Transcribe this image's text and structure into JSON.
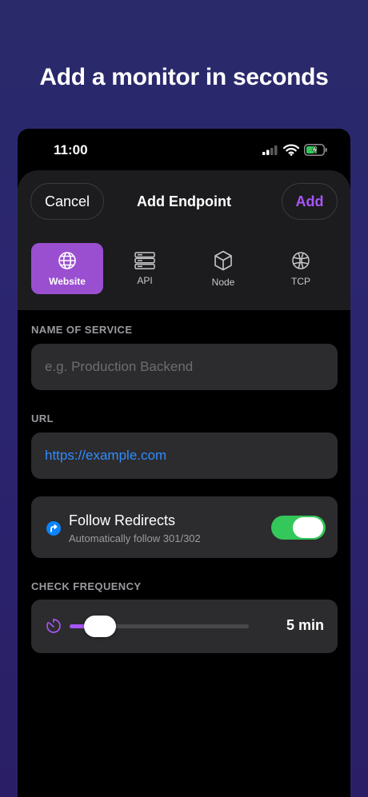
{
  "headline": "Add a monitor in seconds",
  "status_bar": {
    "time": "11:00"
  },
  "header": {
    "cancel_label": "Cancel",
    "title": "Add Endpoint",
    "add_label": "Add"
  },
  "types": [
    {
      "label": "Website",
      "icon": "globe-icon",
      "selected": true
    },
    {
      "label": "API",
      "icon": "server-icon",
      "selected": false
    },
    {
      "label": "Node",
      "icon": "cube-icon",
      "selected": false
    },
    {
      "label": "TCP",
      "icon": "network-globe-icon",
      "selected": false
    }
  ],
  "form": {
    "name_label": "NAME OF SERVICE",
    "name_placeholder": "e.g. Production Backend",
    "url_label": "URL",
    "url_value": "https://example.com",
    "redirects": {
      "title": "Follow Redirects",
      "subtitle": "Automatically follow 301/302",
      "enabled": true
    },
    "frequency_label": "CHECK FREQUENCY",
    "frequency_value": "5 min",
    "frequency_level": 0.1
  },
  "colors": {
    "accent": "#a855f7",
    "toggle_on": "#34c759",
    "link": "#2f8cff"
  }
}
